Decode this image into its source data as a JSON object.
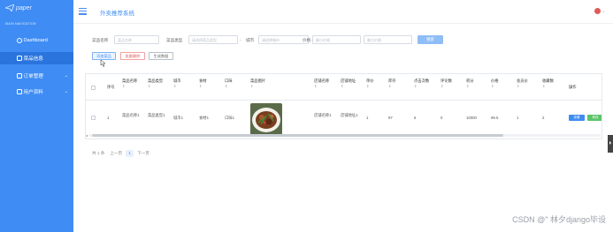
{
  "sidebar": {
    "logo_text": "paper",
    "nav_header": "MAIN NAVIGATION",
    "items": [
      {
        "label": "Dashboard"
      },
      {
        "label": "菜品信息"
      },
      {
        "label": "订单管理"
      },
      {
        "label": "用户资料"
      }
    ]
  },
  "header": {
    "title": "外卖推荐系统"
  },
  "search": {
    "name_label": "菜品名称",
    "name_placeholder": "菜品名称",
    "type_label": "菜品类型",
    "type_placeholder": "请选择菜品类型",
    "city_label": "城市",
    "city_placeholder": "请选择城市",
    "price_label": "价格",
    "price_min_placeholder": "最小价格",
    "price_max_placeholder": "最大价格",
    "search_button": "搜索"
  },
  "actions": {
    "add": "添加菜品",
    "batch_delete": "批量删除",
    "generate": "生成数据"
  },
  "table": {
    "sort_glyph": "⇕",
    "columns": [
      "序号",
      "菜品名称",
      "菜品类型",
      "城市",
      "食材",
      "口味",
      "菜品图片",
      "店铺名称",
      "店铺地址",
      "单价",
      "库存",
      "点击次数",
      "评论数",
      "积分",
      "价格",
      "会员价",
      "收藏数",
      "操作"
    ],
    "rows": [
      {
        "index": "1",
        "name": "菜品名称1",
        "type": "菜品类型1",
        "city": "城市1",
        "ingredients": "食材1",
        "flavor": "口味1",
        "shop_name": "店铺名称1",
        "shop_address": "店铺地址1",
        "unit": "1",
        "stock": "97",
        "clicks": "6",
        "comments": "0",
        "points": "10000",
        "price": "99.5",
        "member_price": "1",
        "favorites": "2",
        "view_button": "查看",
        "edit_button": "修改"
      }
    ]
  },
  "pagination": {
    "total": "共 1 条",
    "prev": "上一页",
    "page": "1",
    "next": "下一页"
  },
  "watermark": "CSDN @\"  林夕django毕设",
  "colors": {
    "sidebar": "#3f8cf4",
    "primary": "#3f8cf4",
    "danger": "#e06060",
    "success": "#5cc46a"
  }
}
